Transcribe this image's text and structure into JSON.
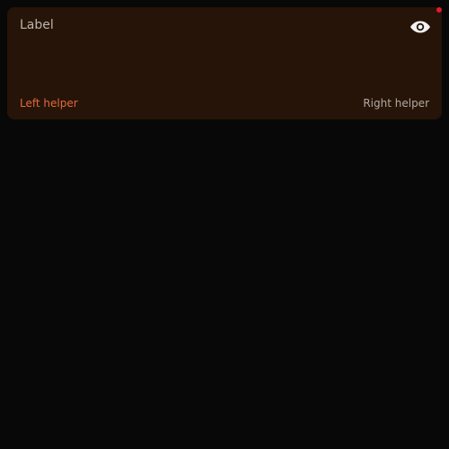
{
  "field": {
    "label": "Label",
    "helper_left": "Left helper",
    "helper_right": "Right helper",
    "trailing_icon": "eye-icon"
  },
  "colors": {
    "background": "#080808",
    "field_background": "#261409",
    "error_dot": "#e31b2a",
    "helper_left": "#e26a3a"
  }
}
